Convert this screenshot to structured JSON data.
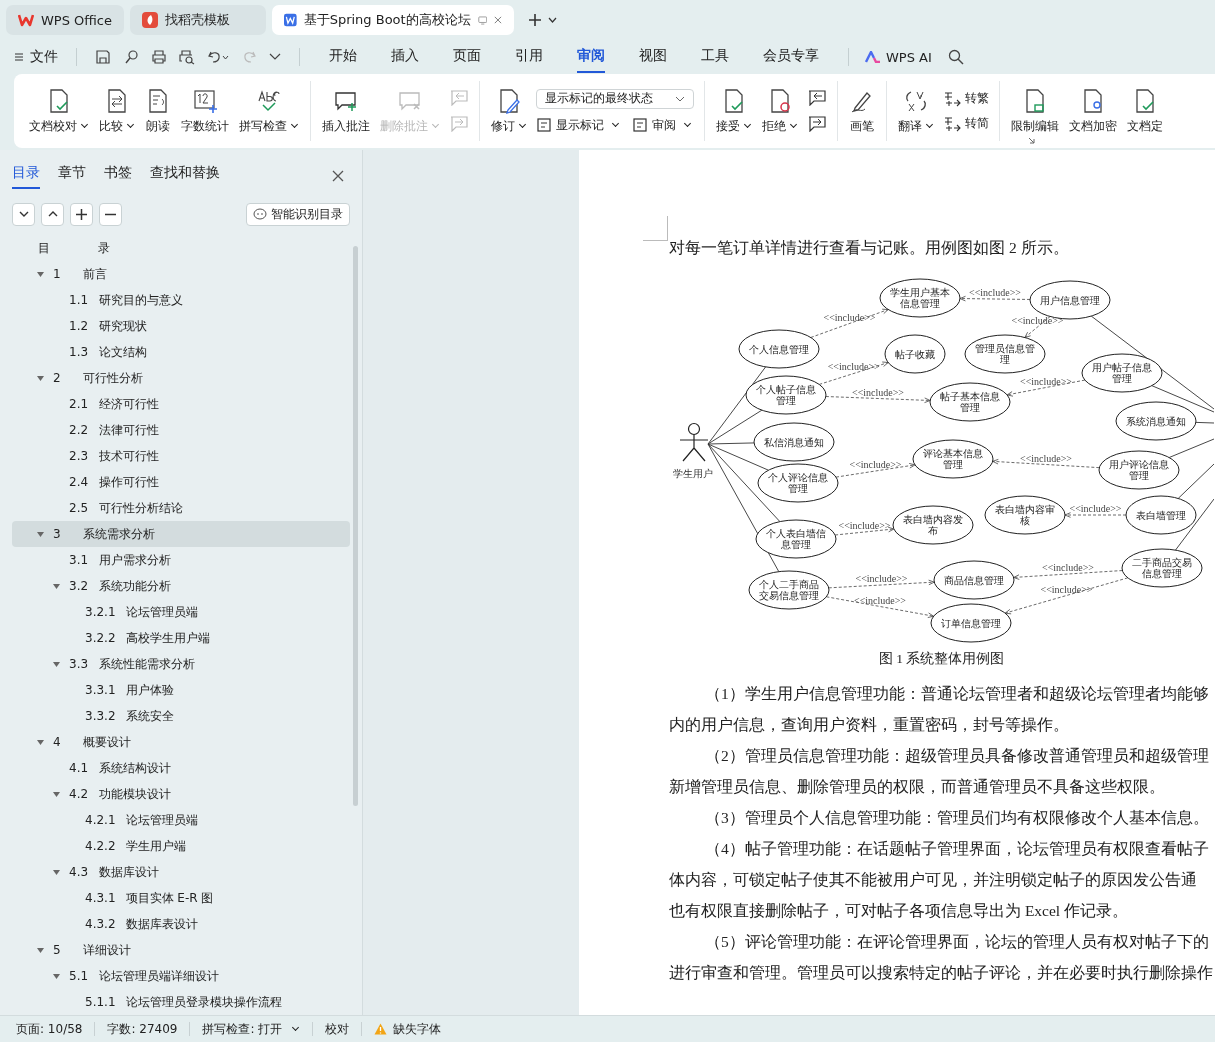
{
  "browser_tabs": [
    {
      "label": "WPS Office",
      "selected": false
    },
    {
      "label": "找稻壳模板",
      "selected": false
    },
    {
      "label": "基于Spring Boot的高校论坛",
      "selected": true
    }
  ],
  "menu": {
    "file": "文件",
    "tabs": [
      {
        "label": "开始",
        "selected": false
      },
      {
        "label": "插入",
        "selected": false
      },
      {
        "label": "页面",
        "selected": false
      },
      {
        "label": "引用",
        "selected": false
      },
      {
        "label": "审阅",
        "selected": true
      },
      {
        "label": "视图",
        "selected": false
      },
      {
        "label": "工具",
        "selected": false
      },
      {
        "label": "会员专享",
        "selected": false
      }
    ],
    "ai": "WPS AI"
  },
  "ribbon": [
    {
      "columns": [
        {
          "items": [
            {
              "kind": "large",
              "label": "文档校对",
              "dropdown": true,
              "disabled": false
            }
          ]
        },
        {
          "items": [
            {
              "kind": "large",
              "label": "比较",
              "dropdown": true,
              "disabled": false
            }
          ]
        },
        {
          "items": [
            {
              "kind": "large",
              "label": "朗读",
              "dropdown": false,
              "disabled": false
            }
          ]
        },
        {
          "items": [
            {
              "kind": "large",
              "label": "字数统计",
              "dropdown": false,
              "disabled": false
            }
          ]
        },
        {
          "items": [
            {
              "kind": "large",
              "label": "拼写检查",
              "dropdown": true,
              "disabled": false
            }
          ]
        }
      ]
    },
    {
      "columns": [
        {
          "items": [
            {
              "kind": "large",
              "label": "插入批注",
              "dropdown": false,
              "disabled": false
            }
          ]
        },
        {
          "items": [
            {
              "kind": "large",
              "label": "删除批注",
              "dropdown": true,
              "disabled": true
            }
          ]
        },
        {
          "items": [
            {
              "kind": "icon",
              "disabled": true
            },
            {
              "kind": "icon",
              "disabled": true
            }
          ]
        }
      ]
    },
    {
      "columns": [
        {
          "items": [
            {
              "kind": "large",
              "label": "修订",
              "dropdown": true,
              "disabled": false
            }
          ]
        },
        {
          "items": [
            {
              "kind": "select",
              "value": "显示标记的最终状态"
            },
            {
              "kind": "row",
              "items": [
                {
                  "kind": "small",
                  "label": "显示标记",
                  "dropdown": true,
                  "disabled": false
                },
                {
                  "kind": "small",
                  "label": "审阅",
                  "dropdown": true,
                  "disabled": false
                }
              ]
            }
          ]
        }
      ]
    },
    {
      "columns": [
        {
          "items": [
            {
              "kind": "large",
              "label": "接受",
              "dropdown": true,
              "disabled": false
            }
          ]
        },
        {
          "items": [
            {
              "kind": "large",
              "label": "拒绝",
              "dropdown": true,
              "disabled": false
            }
          ]
        },
        {
          "items": [
            {
              "kind": "icon",
              "disabled": false
            },
            {
              "kind": "icon",
              "disabled": false
            }
          ]
        }
      ]
    },
    {
      "columns": [
        {
          "items": [
            {
              "kind": "large",
              "label": "画笔",
              "dropdown": false,
              "disabled": false
            }
          ]
        }
      ]
    },
    {
      "columns": [
        {
          "items": [
            {
              "kind": "large",
              "label": "翻译",
              "dropdown": true,
              "disabled": false
            }
          ]
        },
        {
          "items": [
            {
              "kind": "small",
              "label": "转繁",
              "dropdown": false,
              "disabled": false
            },
            {
              "kind": "small",
              "label": "转简",
              "dropdown": false,
              "disabled": false
            }
          ]
        }
      ]
    },
    {
      "columns": [
        {
          "items": [
            {
              "kind": "large",
              "label": "限制编辑",
              "dropdown": false,
              "disabled": false
            }
          ]
        },
        {
          "items": [
            {
              "kind": "large",
              "label": "文档加密",
              "dropdown": false,
              "disabled": false
            }
          ]
        },
        {
          "items": [
            {
              "kind": "large",
              "label": "文档定",
              "dropdown": false,
              "disabled": false
            }
          ]
        }
      ]
    }
  ],
  "sidebar": {
    "tabs": [
      {
        "label": "目录",
        "selected": true
      },
      {
        "label": "章节",
        "selected": false
      },
      {
        "label": "书签",
        "selected": false
      },
      {
        "label": "查找和替换",
        "selected": false
      }
    ],
    "smart_button": "智能识别目录",
    "toc_title": "目　　　　录",
    "toc": [
      {
        "num": "1",
        "title": "前言",
        "selected": false,
        "expanded": true,
        "children": [
          {
            "num": "1.1",
            "title": "研究目的与意义",
            "selected": false
          },
          {
            "num": "1.2",
            "title": "研究现状",
            "selected": false
          },
          {
            "num": "1.3",
            "title": "论文结构",
            "selected": false
          }
        ]
      },
      {
        "num": "2",
        "title": "可行性分析",
        "selected": false,
        "expanded": true,
        "children": [
          {
            "num": "2.1",
            "title": "经济可行性",
            "selected": false
          },
          {
            "num": "2.2",
            "title": "法律可行性",
            "selected": false
          },
          {
            "num": "2.3",
            "title": "技术可行性",
            "selected": false
          },
          {
            "num": "2.4",
            "title": "操作可行性",
            "selected": false
          },
          {
            "num": "2.5",
            "title": "可行性分析结论",
            "selected": false
          }
        ]
      },
      {
        "num": "3",
        "title": "系统需求分析",
        "selected": true,
        "expanded": true,
        "children": [
          {
            "num": "3.1",
            "title": "用户需求分析",
            "selected": false
          },
          {
            "num": "3.2",
            "title": "系统功能分析",
            "selected": false,
            "expanded": true,
            "children": [
              {
                "num": "3.2.1",
                "title": "论坛管理员端",
                "selected": false
              },
              {
                "num": "3.2.2",
                "title": "高校学生用户端",
                "selected": false
              }
            ]
          },
          {
            "num": "3.3",
            "title": "系统性能需求分析",
            "selected": false,
            "expanded": true,
            "children": [
              {
                "num": "3.3.1",
                "title": "用户体验",
                "selected": false
              },
              {
                "num": "3.3.2",
                "title": "系统安全",
                "selected": false
              }
            ]
          }
        ]
      },
      {
        "num": "4",
        "title": "概要设计",
        "selected": false,
        "expanded": true,
        "children": [
          {
            "num": "4.1",
            "title": "系统结构设计",
            "selected": false
          },
          {
            "num": "4.2",
            "title": "功能模块设计",
            "selected": false,
            "expanded": true,
            "children": [
              {
                "num": "4.2.1",
                "title": "论坛管理员端",
                "selected": false
              },
              {
                "num": "4.2.2",
                "title": "学生用户端",
                "selected": false
              }
            ]
          },
          {
            "num": "4.3",
            "title": "数据库设计",
            "selected": false,
            "expanded": true,
            "children": [
              {
                "num": "4.3.1",
                "title": "项目实体 E-R 图",
                "selected": false
              },
              {
                "num": "4.3.2",
                "title": "数据库表设计",
                "selected": false
              }
            ]
          }
        ]
      },
      {
        "num": "5",
        "title": "详细设计",
        "selected": false,
        "expanded": true,
        "children": [
          {
            "num": "5.1",
            "title": "论坛管理员端详细设计",
            "selected": false,
            "expanded": true,
            "children": [
              {
                "num": "5.1.1",
                "title": "论坛管理员登录模块操作流程",
                "selected": false
              }
            ]
          }
        ]
      }
    ]
  },
  "document": {
    "intro": "对每一笔订单详情进行查看与记账。用例图如图 2 所示。",
    "figure": {
      "actor": "学生用户",
      "nodes": [
        {
          "lines": [
            "学生用户基本",
            "信息管理"
          ]
        },
        {
          "lines": [
            "用户信息管理"
          ]
        },
        {
          "lines": [
            "个人信息管理"
          ]
        },
        {
          "lines": [
            "帖子收藏"
          ]
        },
        {
          "lines": [
            "管理员信息管",
            "理"
          ]
        },
        {
          "lines": [
            "用户帖子信息",
            "管理"
          ]
        },
        {
          "lines": [
            "个人帖子信息",
            "管理"
          ]
        },
        {
          "lines": [
            "帖子基本信息",
            "管理"
          ]
        },
        {
          "lines": [
            "系统消息通知"
          ]
        },
        {
          "lines": [
            "私信消息通知"
          ]
        },
        {
          "lines": [
            "评论基本信息",
            "管理"
          ]
        },
        {
          "lines": [
            "用户评论信息",
            "管理"
          ]
        },
        {
          "lines": [
            "个人评论信息",
            "管理"
          ]
        },
        {
          "lines": [
            "表白墙内容发",
            "布"
          ]
        },
        {
          "lines": [
            "表白墙内容审",
            "核"
          ]
        },
        {
          "lines": [
            "表白墙管理"
          ]
        },
        {
          "lines": [
            "个人表白墙信",
            "息管理"
          ]
        },
        {
          "lines": [
            "二手商品交易",
            "信息管理"
          ]
        },
        {
          "lines": [
            "个人二手商品",
            "交易信息管理"
          ]
        },
        {
          "lines": [
            "商品信息管理"
          ]
        },
        {
          "lines": [
            "订单信息管理"
          ]
        }
      ],
      "includes": [
        {
          "label": "<<include>>"
        },
        {
          "label": "<<include>>"
        },
        {
          "label": "<<include>>"
        },
        {
          "label": "<<include>>"
        },
        {
          "label": "<<include>>"
        },
        {
          "label": "<<include>>"
        },
        {
          "label": "<<include>>"
        },
        {
          "label": "<<include>>"
        },
        {
          "label": "<<include>>"
        },
        {
          "label": "<<include>>"
        },
        {
          "label": "<<include>>"
        },
        {
          "label": "<<include>>"
        },
        {
          "label": "<<include>>"
        },
        {
          "label": "<<include>>"
        }
      ],
      "caption": "图 1 系统整体用例图"
    },
    "lines": [
      {
        "kind": "indent",
        "text": "（1）学生用户信息管理功能：普通论坛管理者和超级论坛管理者均能够"
      },
      {
        "kind": "plain",
        "text": "内的用户信息，查询用户资料，重置密码，封号等操作。"
      },
      {
        "kind": "indent",
        "text": "（2）管理员信息管理功能：超级管理员具备修改普通管理员和超级管理"
      },
      {
        "kind": "plain",
        "text": "新增管理员信息、删除管理员的权限，而普通管理员不具备这些权限。"
      },
      {
        "kind": "indent",
        "text": "（3）管理员个人信息管理功能：管理员们均有权限修改个人基本信息。"
      },
      {
        "kind": "indent",
        "text": "（4）帖子管理功能：在话题帖子管理界面，论坛管理员有权限查看帖子"
      },
      {
        "kind": "plain",
        "text": "体内容，可锁定帖子使其不能被用户可见，并注明锁定帖子的原因发公告通"
      },
      {
        "kind": "plain",
        "text": "也有权限直接删除帖子，可对帖子各项信息导出为 Excel 作记录。"
      },
      {
        "kind": "indent",
        "text": "（5）评论管理功能：在评论管理界面，论坛的管理人员有权对帖子下的"
      },
      {
        "kind": "plain",
        "text": "进行审查和管理。管理员可以搜索特定的帖子评论，并在必要时执行删除操作"
      }
    ]
  },
  "status_bar": [
    {
      "kind": "plain",
      "text": "页面: 10/58"
    },
    {
      "kind": "plain",
      "text": "字数: 27409"
    },
    {
      "kind": "dropdown",
      "text": "拼写检查: 打开"
    },
    {
      "kind": "plain",
      "text": "校对"
    },
    {
      "kind": "warning",
      "text": "缺失字体"
    }
  ]
}
